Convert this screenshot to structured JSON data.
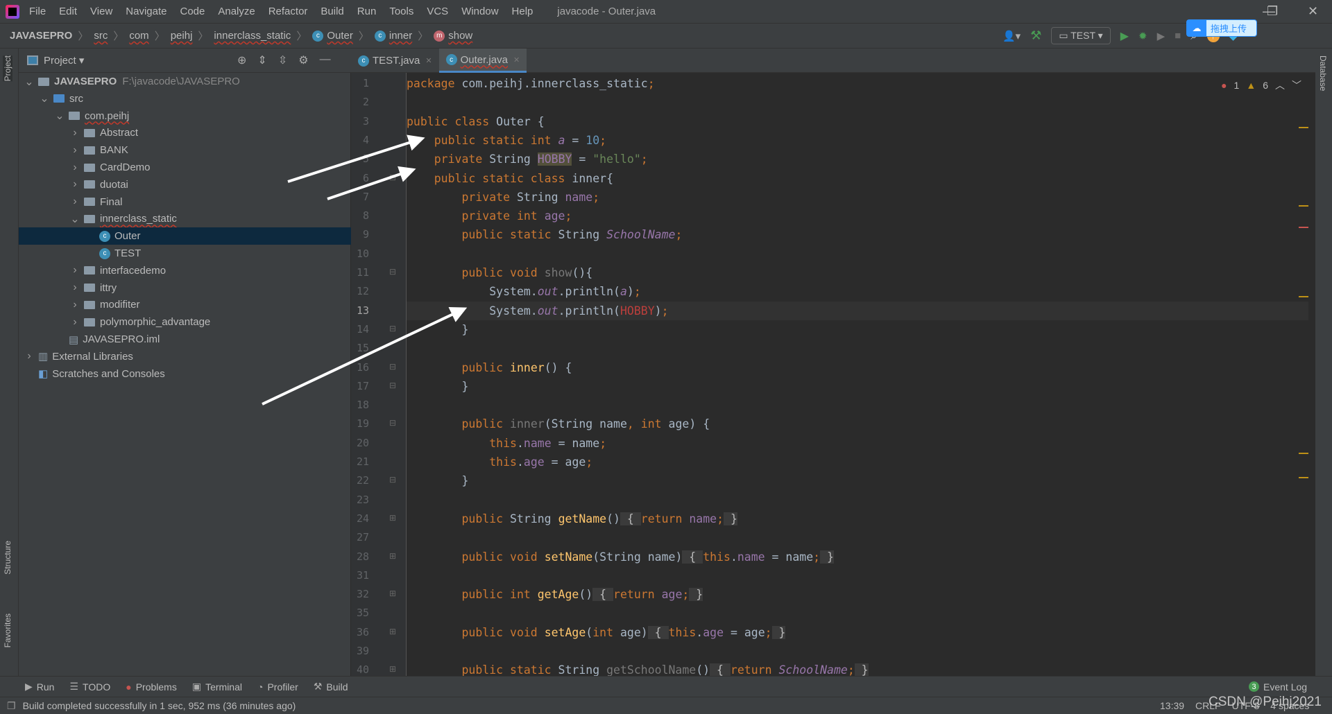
{
  "menubar": {
    "items": [
      "File",
      "Edit",
      "View",
      "Navigate",
      "Code",
      "Analyze",
      "Refactor",
      "Build",
      "Run",
      "Tools",
      "VCS",
      "Window",
      "Help"
    ],
    "title": "javacode - Outer.java"
  },
  "breadcrumb": [
    {
      "label": "JAVASEPRO",
      "icon": ""
    },
    {
      "label": "src",
      "icon": ""
    },
    {
      "label": "com",
      "icon": ""
    },
    {
      "label": "peihj",
      "icon": ""
    },
    {
      "label": "innerclass_static",
      "icon": ""
    },
    {
      "label": "Outer",
      "icon": "c"
    },
    {
      "label": "inner",
      "icon": "c"
    },
    {
      "label": "show",
      "icon": "m"
    }
  ],
  "toolbar": {
    "run_config": "TEST",
    "upload_badge": "拖拽上传"
  },
  "project": {
    "title": "Project",
    "tree": [
      {
        "label": "JAVASEPRO",
        "extra": "F:\\javacode\\JAVASEPRO",
        "depth": 0,
        "chev": "v",
        "type": "module"
      },
      {
        "label": "src",
        "depth": 1,
        "chev": "v",
        "type": "srcfolder"
      },
      {
        "label": "com.peihj",
        "depth": 2,
        "chev": "v",
        "type": "package"
      },
      {
        "label": "Abstract",
        "depth": 3,
        "chev": ">",
        "type": "package"
      },
      {
        "label": "BANK",
        "depth": 3,
        "chev": ">",
        "type": "package"
      },
      {
        "label": "CardDemo",
        "depth": 3,
        "chev": ">",
        "type": "package"
      },
      {
        "label": "duotai",
        "depth": 3,
        "chev": ">",
        "type": "package"
      },
      {
        "label": "Final",
        "depth": 3,
        "chev": ">",
        "type": "package"
      },
      {
        "label": "innerclass_static",
        "depth": 3,
        "chev": "v",
        "type": "package"
      },
      {
        "label": "Outer",
        "depth": 4,
        "chev": "",
        "type": "class",
        "selected": true
      },
      {
        "label": "TEST",
        "depth": 4,
        "chev": "",
        "type": "class"
      },
      {
        "label": "interfacedemo",
        "depth": 3,
        "chev": ">",
        "type": "package"
      },
      {
        "label": "ittry",
        "depth": 3,
        "chev": ">",
        "type": "package"
      },
      {
        "label": "modifiter",
        "depth": 3,
        "chev": ">",
        "type": "package"
      },
      {
        "label": "polymorphic_advantage",
        "depth": 3,
        "chev": ">",
        "type": "package"
      },
      {
        "label": "JAVASEPRO.iml",
        "depth": 2,
        "chev": "",
        "type": "iml"
      },
      {
        "label": "External Libraries",
        "depth": 0,
        "chev": ">",
        "type": "lib"
      },
      {
        "label": "Scratches and Consoles",
        "depth": 0,
        "chev": "",
        "type": "scratch"
      }
    ]
  },
  "tabs": [
    {
      "label": "TEST.java",
      "active": false
    },
    {
      "label": "Outer.java",
      "active": true
    }
  ],
  "inspections": {
    "errors": "1",
    "warnings": "6"
  },
  "editor": {
    "current_line": "13",
    "lines": [
      {
        "n": "1",
        "t": [
          [
            "package ",
            "kw"
          ],
          [
            "com.peihj.innerclass_static",
            "id"
          ],
          [
            ";",
            "kw"
          ]
        ]
      },
      {
        "n": "2",
        "t": []
      },
      {
        "n": "3",
        "t": [
          [
            "public class ",
            "kw"
          ],
          [
            "Outer {",
            "id"
          ]
        ]
      },
      {
        "n": "4",
        "t": [
          [
            "    public static int ",
            "kw"
          ],
          [
            "a",
            "sf"
          ],
          [
            " = ",
            "id"
          ],
          [
            "10",
            "num"
          ],
          [
            ";",
            "kw"
          ]
        ]
      },
      {
        "n": "5",
        "t": [
          [
            "    private ",
            "kw"
          ],
          [
            "String ",
            "id"
          ],
          [
            "HOBBY",
            "hl"
          ],
          [
            " = ",
            "id"
          ],
          [
            "\"hello\"",
            "str"
          ],
          [
            ";",
            "kw"
          ]
        ]
      },
      {
        "n": "6",
        "t": [
          [
            "    public static class ",
            "kw"
          ],
          [
            "inner{",
            "id"
          ]
        ]
      },
      {
        "n": "7",
        "t": [
          [
            "        private ",
            "kw"
          ],
          [
            "String ",
            "id"
          ],
          [
            "name",
            "fld"
          ],
          [
            ";",
            "kw"
          ]
        ]
      },
      {
        "n": "8",
        "t": [
          [
            "        private int ",
            "kw"
          ],
          [
            "age",
            "fld"
          ],
          [
            ";",
            "kw"
          ]
        ]
      },
      {
        "n": "9",
        "t": [
          [
            "        public static ",
            "kw"
          ],
          [
            "String ",
            "id"
          ],
          [
            "SchoolName",
            "sf"
          ],
          [
            ";",
            "kw"
          ]
        ]
      },
      {
        "n": "10",
        "t": []
      },
      {
        "n": "11",
        "t": [
          [
            "        public void ",
            "kw"
          ],
          [
            "show",
            "unused"
          ],
          [
            "(){",
            "id"
          ]
        ]
      },
      {
        "n": "12",
        "t": [
          [
            "            System.",
            "id"
          ],
          [
            "out",
            "sf"
          ],
          [
            ".println(",
            "id"
          ],
          [
            "a",
            "sf"
          ],
          [
            ")",
            "id"
          ],
          [
            ";",
            "kw"
          ]
        ]
      },
      {
        "n": "13",
        "t": [
          [
            "            System.",
            "id"
          ],
          [
            "out",
            "sf"
          ],
          [
            ".println(",
            "id"
          ],
          [
            "HOBBY",
            "err"
          ],
          [
            ")",
            "id"
          ],
          [
            ";",
            "kw"
          ]
        ]
      },
      {
        "n": "14",
        "t": [
          [
            "        }",
            "id"
          ]
        ]
      },
      {
        "n": "15",
        "t": []
      },
      {
        "n": "16",
        "t": [
          [
            "        public ",
            "kw"
          ],
          [
            "inner",
            "fn"
          ],
          [
            "() {",
            "id"
          ]
        ]
      },
      {
        "n": "17",
        "t": [
          [
            "        }",
            "id"
          ]
        ]
      },
      {
        "n": "18",
        "t": []
      },
      {
        "n": "19",
        "t": [
          [
            "        public ",
            "kw"
          ],
          [
            "inner",
            "unused"
          ],
          [
            "(String name",
            "id"
          ],
          [
            ", ",
            "kw"
          ],
          [
            "int ",
            "kw"
          ],
          [
            "age) {",
            "id"
          ]
        ]
      },
      {
        "n": "20",
        "t": [
          [
            "            this",
            "kw"
          ],
          [
            ".",
            "id"
          ],
          [
            "name",
            "fld"
          ],
          [
            " = name",
            "id"
          ],
          [
            ";",
            "kw"
          ]
        ]
      },
      {
        "n": "21",
        "t": [
          [
            "            this",
            "kw"
          ],
          [
            ".",
            "id"
          ],
          [
            "age",
            "fld"
          ],
          [
            " = age",
            "id"
          ],
          [
            ";",
            "kw"
          ]
        ]
      },
      {
        "n": "22",
        "t": [
          [
            "        }",
            "id"
          ]
        ]
      },
      {
        "n": "23",
        "t": []
      },
      {
        "n": "24",
        "t": [
          [
            "        public ",
            "kw"
          ],
          [
            "String ",
            "id"
          ],
          [
            "getName",
            "fn"
          ],
          [
            "()",
            "id"
          ],
          [
            " { ",
            "fb"
          ],
          [
            "return ",
            "kw"
          ],
          [
            "name",
            "fld"
          ],
          [
            ";",
            "kw"
          ],
          [
            " }",
            "fb"
          ]
        ]
      },
      {
        "n": "27",
        "t": []
      },
      {
        "n": "28",
        "t": [
          [
            "        public void ",
            "kw"
          ],
          [
            "setName",
            "fn"
          ],
          [
            "(String name)",
            "id"
          ],
          [
            " { ",
            "fb"
          ],
          [
            "this",
            "kw"
          ],
          [
            ".",
            "id"
          ],
          [
            "name",
            "fld"
          ],
          [
            " = name",
            "id"
          ],
          [
            ";",
            "kw"
          ],
          [
            " }",
            "fb"
          ]
        ]
      },
      {
        "n": "31",
        "t": []
      },
      {
        "n": "32",
        "t": [
          [
            "        public int ",
            "kw"
          ],
          [
            "getAge",
            "fn"
          ],
          [
            "()",
            "id"
          ],
          [
            " { ",
            "fb"
          ],
          [
            "return ",
            "kw"
          ],
          [
            "age",
            "fld"
          ],
          [
            ";",
            "kw"
          ],
          [
            " }",
            "fb"
          ]
        ]
      },
      {
        "n": "35",
        "t": []
      },
      {
        "n": "36",
        "t": [
          [
            "        public void ",
            "kw"
          ],
          [
            "setAge",
            "fn"
          ],
          [
            "(",
            "id"
          ],
          [
            "int ",
            "kw"
          ],
          [
            "age)",
            "id"
          ],
          [
            " { ",
            "fb"
          ],
          [
            "this",
            "kw"
          ],
          [
            ".",
            "id"
          ],
          [
            "age",
            "fld"
          ],
          [
            " = age",
            "id"
          ],
          [
            ";",
            "kw"
          ],
          [
            " }",
            "fb"
          ]
        ]
      },
      {
        "n": "39",
        "t": []
      },
      {
        "n": "40",
        "t": [
          [
            "        public static ",
            "kw"
          ],
          [
            "String ",
            "id"
          ],
          [
            "getSchoolName",
            "unused"
          ],
          [
            "()",
            "id"
          ],
          [
            " { ",
            "fb"
          ],
          [
            "return ",
            "kw"
          ],
          [
            "SchoolName",
            "sf"
          ],
          [
            ";",
            "kw"
          ],
          [
            " }",
            "fb"
          ]
        ]
      }
    ]
  },
  "bottom_tools": [
    {
      "label": "Run",
      "icon": "▶"
    },
    {
      "label": "TODO",
      "icon": "☰"
    },
    {
      "label": "Problems",
      "icon": "●"
    },
    {
      "label": "Terminal",
      "icon": "▣"
    },
    {
      "label": "Profiler",
      "icon": "◔"
    },
    {
      "label": "Build",
      "icon": "⚒"
    }
  ],
  "event_log": {
    "count": "3",
    "label": "Event Log"
  },
  "status": {
    "message": "Build completed successfully in 1 sec, 952 ms (36 minutes ago)",
    "position": "13:39",
    "line_sep": "CRLF",
    "encoding": "UTF-8",
    "indent": "4 spaces"
  },
  "side_labels": {
    "project": "Project",
    "structure": "Structure",
    "favorites": "Favorites",
    "database": "Database"
  },
  "watermark": "CSDN @Peihj2021",
  "colors": {
    "keyword": "#cc7832",
    "field": "#9876aa",
    "string": "#6a8759",
    "number": "#6897bb",
    "method": "#ffc66d",
    "error": "#bc3f3c",
    "selection": "#0d293e",
    "accent": "#4a88c7"
  }
}
